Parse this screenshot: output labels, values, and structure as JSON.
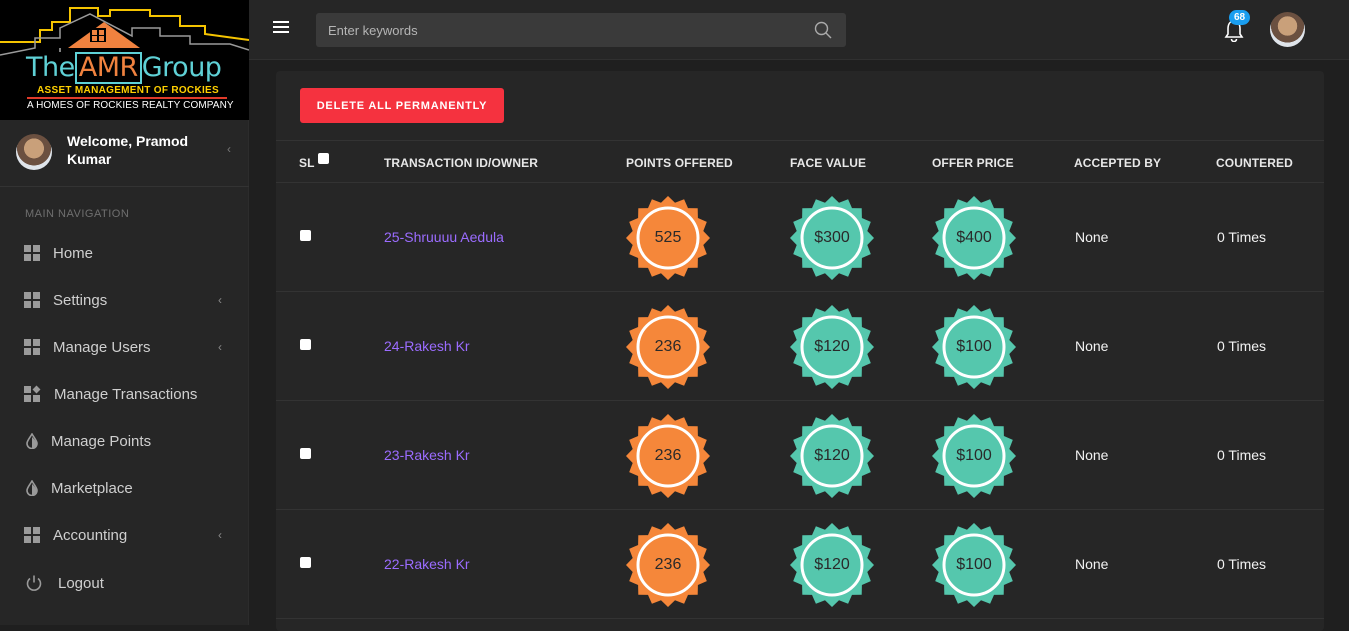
{
  "logo": {
    "brand_the": "The",
    "brand_amr": "AMR",
    "brand_group": "Group",
    "tagline": "ASSET MANAGEMENT OF ROCKIES",
    "company": "A HOMES OF ROCKIES REALTY COMPANY"
  },
  "user": {
    "welcome": "Welcome, Pramod Kumar"
  },
  "nav": {
    "header": "MAIN NAVIGATION",
    "items": [
      {
        "label": "Home",
        "icon": "grid-icon",
        "has_arrow": false
      },
      {
        "label": "Settings",
        "icon": "grid-icon",
        "has_arrow": true
      },
      {
        "label": "Manage Users",
        "icon": "grid-icon",
        "has_arrow": true
      },
      {
        "label": "Manage Transactions",
        "icon": "transactions-icon",
        "has_arrow": false
      },
      {
        "label": "Manage Points",
        "icon": "drop-icon",
        "has_arrow": false
      },
      {
        "label": "Marketplace",
        "icon": "drop-icon",
        "has_arrow": false
      },
      {
        "label": "Accounting",
        "icon": "grid-icon",
        "has_arrow": true
      },
      {
        "label": "Logout",
        "icon": "power-icon",
        "has_arrow": false
      }
    ]
  },
  "topbar": {
    "search_placeholder": "Enter keywords",
    "notification_count": "68"
  },
  "actions": {
    "delete_all": "DELETE ALL PERMANENTLY"
  },
  "table": {
    "headers": {
      "sl": "SL",
      "txid": "TRANSACTION ID/OWNER",
      "points": "POINTS OFFERED",
      "face": "FACE VALUE",
      "offer": "OFFER PRICE",
      "accepted": "ACCEPTED BY",
      "countered": "COUNTERED"
    },
    "rows": [
      {
        "txid": "25-Shruuuu Aedula",
        "points": "525",
        "face": "$300",
        "offer": "$400",
        "accepted": "None",
        "countered": "0 Times"
      },
      {
        "txid": "24-Rakesh Kr",
        "points": "236",
        "face": "$120",
        "offer": "$100",
        "accepted": "None",
        "countered": "0 Times"
      },
      {
        "txid": "23-Rakesh Kr",
        "points": "236",
        "face": "$120",
        "offer": "$100",
        "accepted": "None",
        "countered": "0 Times"
      },
      {
        "txid": "22-Rakesh Kr",
        "points": "236",
        "face": "$120",
        "offer": "$100",
        "accepted": "None",
        "countered": "0 Times"
      }
    ]
  },
  "colors": {
    "points_seal": "#f5873a",
    "money_seal": "#55c7ad",
    "link": "#9b6cff",
    "danger": "#f5323f",
    "badge": "#1a9ef0"
  }
}
